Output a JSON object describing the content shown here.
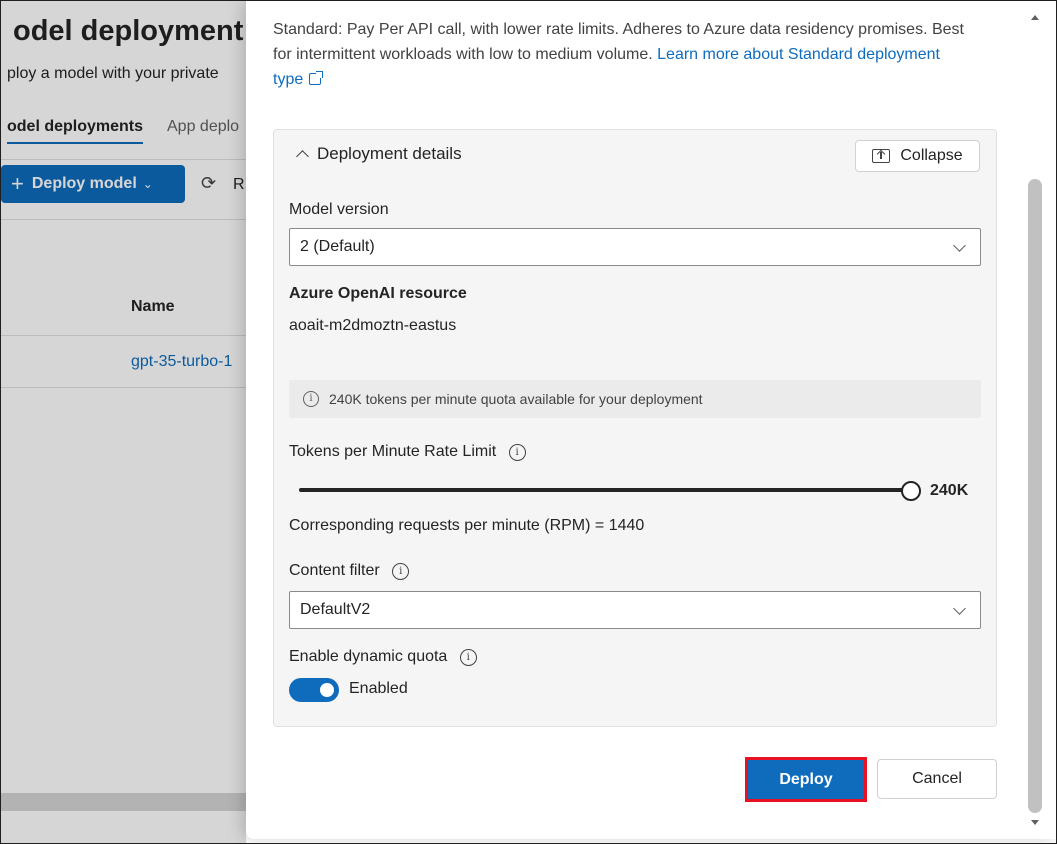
{
  "background": {
    "title": "odel deployment",
    "subtitle": "ploy a model with your private",
    "tabs": [
      {
        "label": "odel deployments"
      },
      {
        "label": "App deplo"
      }
    ],
    "toolbar": {
      "deploy_label": "Deploy model",
      "refresh_label": "R"
    },
    "table": {
      "column_name": "Name",
      "rows": [
        {
          "name": "gpt-35-turbo-1"
        }
      ]
    }
  },
  "dialog": {
    "intro_text": "Standard: Pay Per API call, with lower rate limits. Adheres to Azure data residency promises. Best for intermittent workloads with low to medium volume. ",
    "intro_link": "Learn more about Standard deployment type",
    "section": {
      "title": "Deployment details",
      "collapse_label": "Collapse",
      "model_version_label": "Model version",
      "model_version_value": "2 (Default)",
      "resource_label": "Azure OpenAI resource",
      "resource_value": "aoait-m2dmoztn-eastus",
      "quota_info": "240K tokens per minute quota available for your deployment",
      "tpm_label": "Tokens per Minute Rate Limit",
      "tpm_value": "240K",
      "tpm_fraction": 1.0,
      "rpm_text": "Corresponding requests per minute (RPM) = 1440",
      "content_filter_label": "Content filter",
      "content_filter_value": "DefaultV2",
      "dynamic_quota_label": "Enable dynamic quota",
      "dynamic_quota_state": "Enabled"
    },
    "buttons": {
      "deploy": "Deploy",
      "cancel": "Cancel"
    }
  },
  "colors": {
    "accent": "#0f6cbd",
    "highlight": "#e81123"
  }
}
